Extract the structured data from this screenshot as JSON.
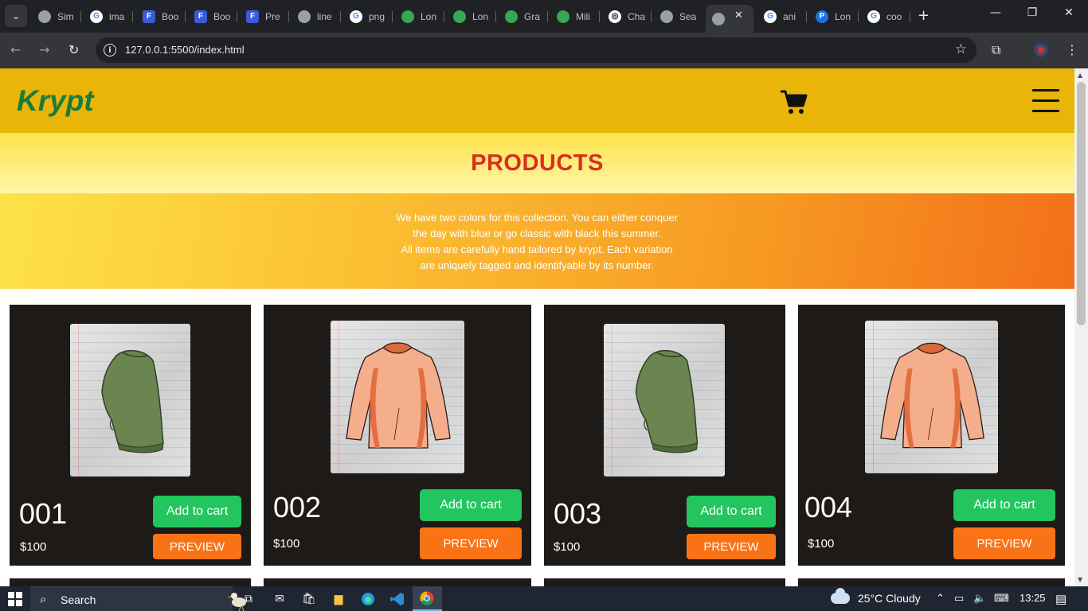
{
  "browser": {
    "tabs": [
      {
        "label": "Sim",
        "icon": "globe-icon"
      },
      {
        "label": "ima",
        "icon": "google-icon"
      },
      {
        "label": "Boo",
        "icon": "formspree-icon"
      },
      {
        "label": "Boo",
        "icon": "formspree-icon"
      },
      {
        "label": "Pre",
        "icon": "formspree-icon"
      },
      {
        "label": "line",
        "icon": "globe-icon"
      },
      {
        "label": "png",
        "icon": "google-icon"
      },
      {
        "label": "Lon",
        "icon": "green-leaf-icon"
      },
      {
        "label": "Lon",
        "icon": "green-leaf-icon"
      },
      {
        "label": "Gra",
        "icon": "green-leaf-icon"
      },
      {
        "label": "Mili",
        "icon": "green-leaf-icon"
      },
      {
        "label": "Cha",
        "icon": "openai-icon"
      },
      {
        "label": "Sea",
        "icon": "globe-icon"
      },
      {
        "label": "",
        "icon": "globe-icon",
        "active": true
      },
      {
        "label": "ani",
        "icon": "google-icon"
      },
      {
        "label": "Lon",
        "icon": "p-icon"
      },
      {
        "label": "coo",
        "icon": "google-icon"
      }
    ],
    "url": "127.0.0.1:5500/index.html"
  },
  "site": {
    "brand": "Krypt",
    "section_title": "PRODUCTS",
    "description_lines": [
      "We have two colors for this collection. You can either conquer",
      "the day with blue or go classic with black this summer.",
      "All items are carefully hand tailored by krypt. Each variation",
      "are uniquely tagged and identifyable by its number."
    ],
    "colors": {
      "header": "#e8b508",
      "brand": "#1e7a3a",
      "title": "#d92d22",
      "card": "#1e1a17",
      "add_to_cart": "#22c55e",
      "preview": "#f97316"
    }
  },
  "products": [
    {
      "number": "001",
      "price": "$100",
      "add_label": "Add to cart",
      "preview_label": "PREVIEW",
      "image": "green-sweater"
    },
    {
      "number": "002",
      "price": "$100",
      "add_label": "Add to cart",
      "preview_label": "PREVIEW",
      "image": "peach-sweater"
    },
    {
      "number": "003",
      "price": "$100",
      "add_label": "Add to cart",
      "preview_label": "PREVIEW",
      "image": "green-sweater"
    },
    {
      "number": "004",
      "price": "$100",
      "add_label": "Add to cart",
      "preview_label": "PREVIEW",
      "image": "peach-sweater"
    }
  ],
  "taskbar": {
    "search_label": "Search",
    "weather": "25°C  Cloudy",
    "time": "13:25"
  }
}
